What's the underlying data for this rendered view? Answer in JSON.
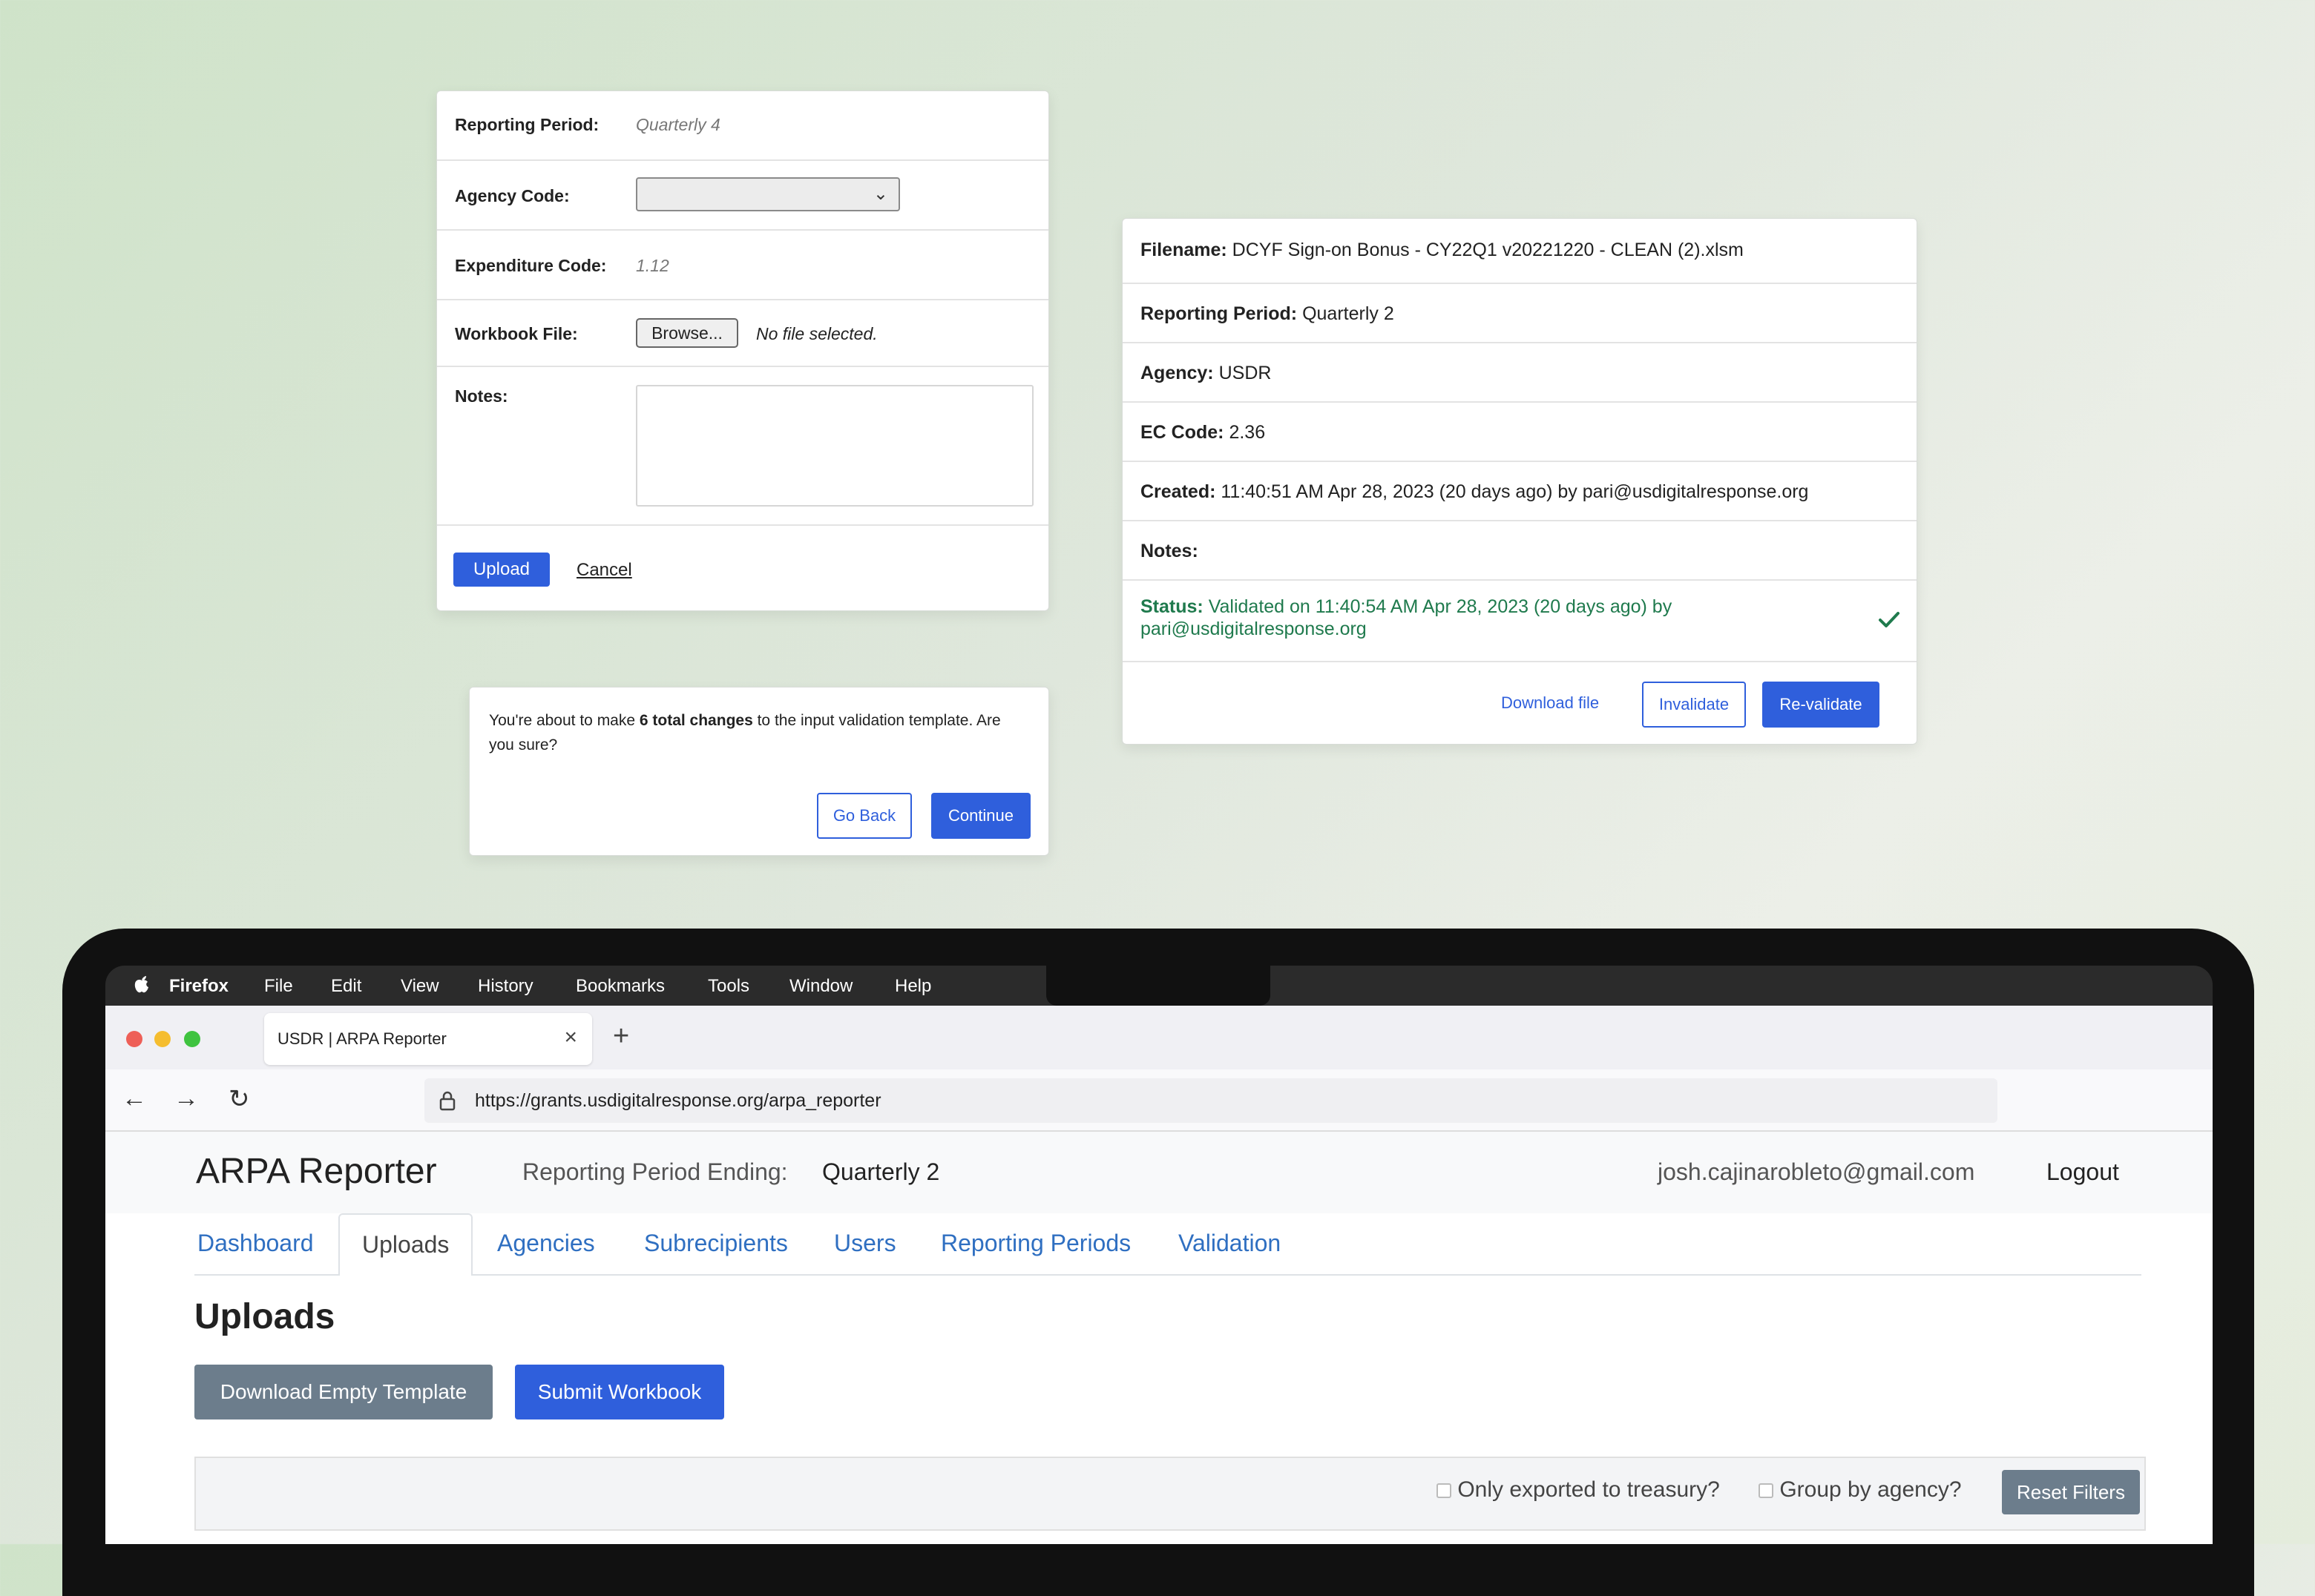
{
  "upload_form": {
    "reporting_period_label": "Reporting Period:",
    "reporting_period_value": "Quarterly 4",
    "agency_code_label": "Agency Code:",
    "agency_code_value": "",
    "expenditure_code_label": "Expenditure Code:",
    "expenditure_code_value": "1.12",
    "workbook_file_label": "Workbook File:",
    "browse_label": "Browse...",
    "no_file_text": "No file selected.",
    "notes_label": "Notes:",
    "notes_value": "",
    "upload_label": "Upload",
    "cancel_label": "Cancel"
  },
  "confirm_dialog": {
    "text_before": "You're about to make ",
    "text_bold": "6 total changes",
    "text_after": " to the input validation template. Are you sure?",
    "go_back_label": "Go Back",
    "continue_label": "Continue"
  },
  "upload_details": {
    "filename_label": "Filename:",
    "filename_value": "DCYF Sign-on Bonus - CY22Q1 v20221220 - CLEAN (2).xlsm",
    "reporting_period_label": "Reporting Period:",
    "reporting_period_value": "Quarterly 2",
    "agency_label": "Agency:",
    "agency_value": "USDR",
    "ec_code_label": "EC Code:",
    "ec_code_value": "2.36",
    "created_label": "Created:",
    "created_value": "11:40:51 AM Apr 28, 2023 (20 days ago) by pari@usdigitalresponse.org",
    "notes_label": "Notes:",
    "status_label": "Status:",
    "status_value": "Validated on 11:40:54 AM Apr 28, 2023 (20 days ago) by",
    "status_value_line2": "pari@usdigitalresponse.org",
    "status_color": "#1f7a4d",
    "download_file_label": "Download file",
    "invalidate_label": "Invalidate",
    "revalidate_label": "Re-validate"
  },
  "macos_menubar": {
    "apple_icon": "apple-icon",
    "app_name": "Firefox",
    "items": [
      "File",
      "Edit",
      "View",
      "History",
      "Bookmarks",
      "Tools",
      "Window",
      "Help"
    ]
  },
  "browser": {
    "tab_title": "USDR | ARPA Reporter",
    "url": "https://grants.usdigitalresponse.org/arpa_reporter",
    "traffic_lights": [
      "#ee5f57",
      "#f5bd2f",
      "#3fc33f"
    ]
  },
  "app": {
    "title": "ARPA Reporter",
    "reporting_period_label": "Reporting Period Ending:",
    "reporting_period_value": "Quarterly 2",
    "user_email": "josh.cajinarobleto@gmail.com",
    "logout_label": "Logout",
    "nav_tabs": [
      "Dashboard",
      "Uploads",
      "Agencies",
      "Subrecipients",
      "Users",
      "Reporting Periods",
      "Validation"
    ],
    "active_tab": "Uploads",
    "page_title": "Uploads",
    "download_template_label": "Download Empty Template",
    "submit_workbook_label": "Submit Workbook",
    "filter_exported_label": "Only exported to treasury?",
    "filter_group_label": "Group by agency?",
    "reset_filters_label": "Reset Filters",
    "accent_color": "#2f5fdc",
    "secondary_color": "#6c7d8c"
  }
}
